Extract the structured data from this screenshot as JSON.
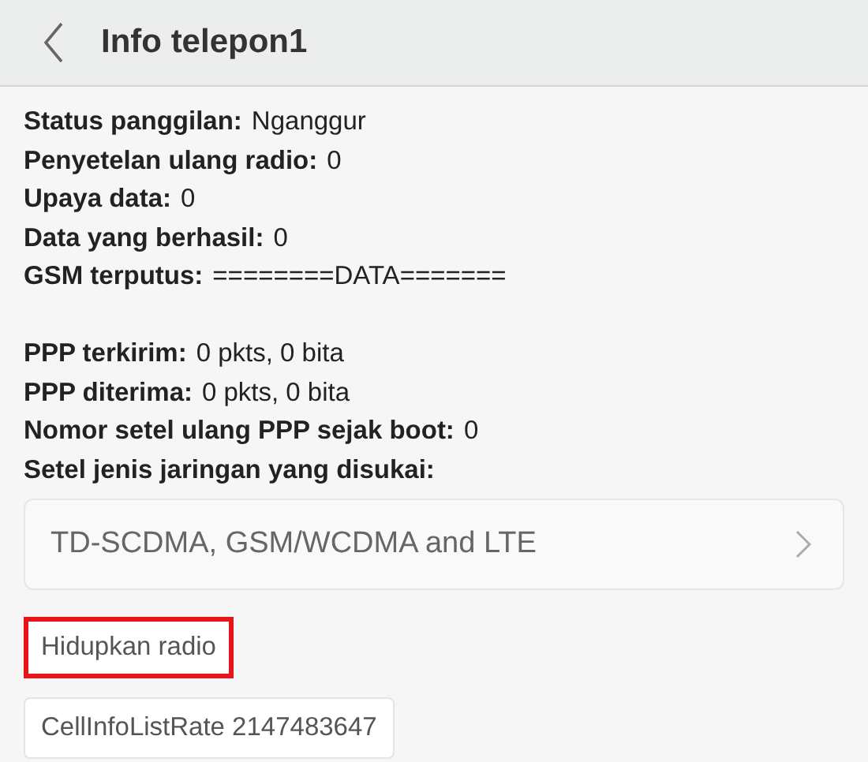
{
  "header": {
    "title": "Info telepon1"
  },
  "info_groups": [
    [
      {
        "label": "Status panggilan:",
        "value": "Nganggur"
      },
      {
        "label": "Penyetelan ulang radio:",
        "value": "0"
      },
      {
        "label": "Upaya data:",
        "value": "0"
      },
      {
        "label": "Data yang berhasil:",
        "value": "0"
      },
      {
        "label": "GSM terputus:",
        "value": "========DATA======="
      }
    ],
    [
      {
        "label": "PPP terkirim:",
        "value": "0 pkts, 0 bita"
      },
      {
        "label": "PPP diterima:",
        "value": "0 pkts, 0 bita"
      },
      {
        "label": "Nomor setel ulang PPP sejak boot:",
        "value": "0"
      },
      {
        "label": "Setel jenis jaringan yang disukai:"
      }
    ]
  ],
  "network_select": {
    "value": "TD-SCDMA, GSM/WCDMA and LTE"
  },
  "buttons": [
    {
      "label": "Hidupkan radio",
      "highlighted": true
    },
    {
      "label": "CellInfoListRate 2147483647",
      "highlighted": false
    }
  ]
}
